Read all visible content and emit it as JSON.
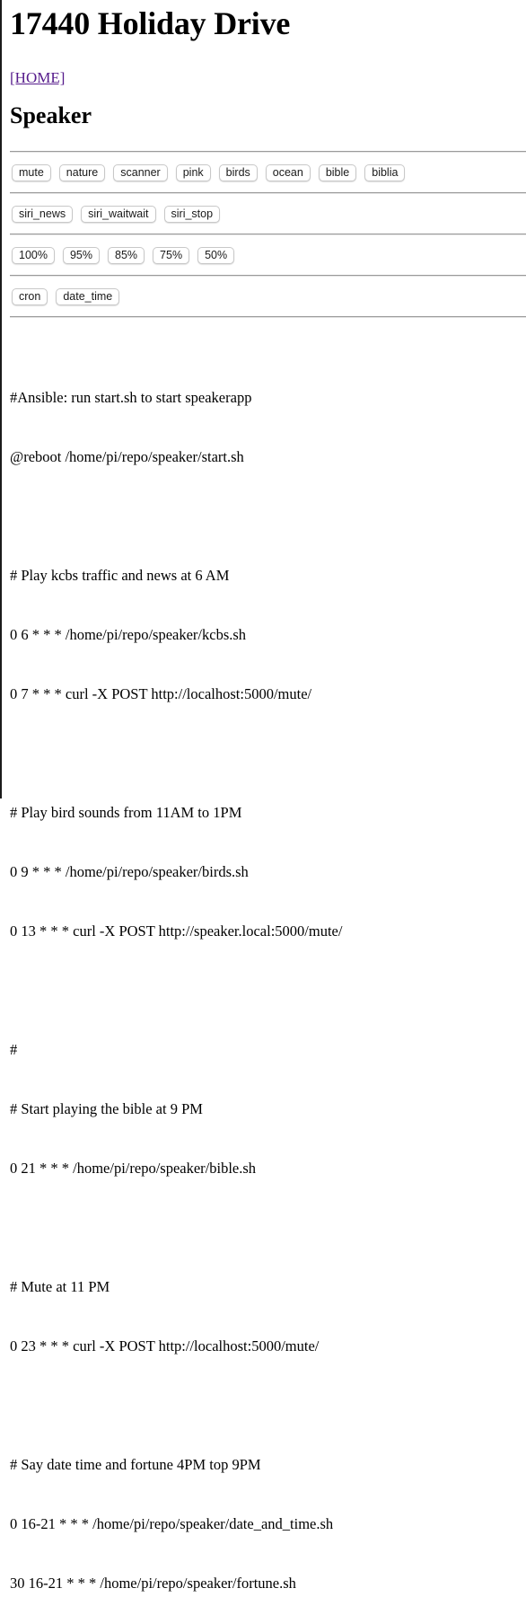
{
  "page": {
    "title": "17440 Holiday Drive",
    "home_link": "[HOME]",
    "section_title": "Speaker"
  },
  "button_rows": [
    [
      "mute",
      "nature",
      "scanner",
      "pink",
      "birds",
      "ocean",
      "bible",
      "biblia"
    ],
    [
      "siri_news",
      "siri_waitwait",
      "siri_stop"
    ],
    [
      "100%",
      "95%",
      "85%",
      "75%",
      "50%"
    ],
    [
      "cron",
      "date_time"
    ]
  ],
  "cron_lines": [
    "#Ansible: run start.sh to start speakerapp",
    "@reboot /home/pi/repo/speaker/start.sh",
    "",
    "# Play kcbs traffic and news at 6 AM",
    "0 6 * * * /home/pi/repo/speaker/kcbs.sh",
    "0 7 * * * curl -X POST http://localhost:5000/mute/",
    "",
    "# Play bird sounds from 11AM to 1PM",
    "0 9 * * * /home/pi/repo/speaker/birds.sh",
    "0 13 * * * curl -X POST http://speaker.local:5000/mute/",
    "",
    "#",
    "# Start playing the bible at 9 PM",
    "0 21 * * * /home/pi/repo/speaker/bible.sh",
    "",
    "# Mute at 11 PM",
    "0 23 * * * curl -X POST http://localhost:5000/mute/",
    "",
    "# Say date time and fortune 4PM top 9PM",
    "0 16-21 * * * /home/pi/repo/speaker/date_and_time.sh",
    "30 16-21 * * * /home/pi/repo/speaker/fortune.sh"
  ],
  "colors": {
    "link_visited": "#551a8b",
    "rule": "#9a9a9a",
    "button_border": "#c8c8c8"
  }
}
